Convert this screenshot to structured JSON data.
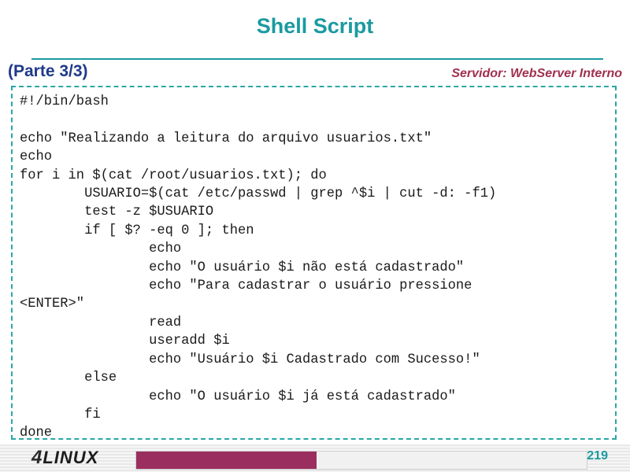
{
  "slide": {
    "title": "Shell Script",
    "part": "(Parte 3/3)",
    "server": "Servidor: WebServer Interno"
  },
  "code": {
    "text": "#!/bin/bash\n\necho \"Realizando a leitura do arquivo usuarios.txt\"\necho\nfor i in $(cat /root/usuarios.txt); do\n        USUARIO=$(cat /etc/passwd | grep ^$i | cut -d: -f1)\n        test -z $USUARIO\n        if [ $? -eq 0 ]; then\n                echo\n                echo \"O usuário $i não está cadastrado\"\n                echo \"Para cadastrar o usuário pressione\n<ENTER>\"\n                read\n                useradd $i\n                echo \"Usuário $i Cadastrado com Sucesso!\"\n        else\n                echo \"O usuário $i já está cadastrado\"\n        fi\ndone"
  },
  "footer": {
    "logo_number": "4",
    "logo_text": "LINUX",
    "page_number": "219",
    "progress_fraction": 0.4,
    "progress_color": "#9a2f5f"
  },
  "colors": {
    "title": "#1a9aa0",
    "part": "#1f3a8a",
    "server": "#a03050",
    "border": "#2aa7a7"
  }
}
